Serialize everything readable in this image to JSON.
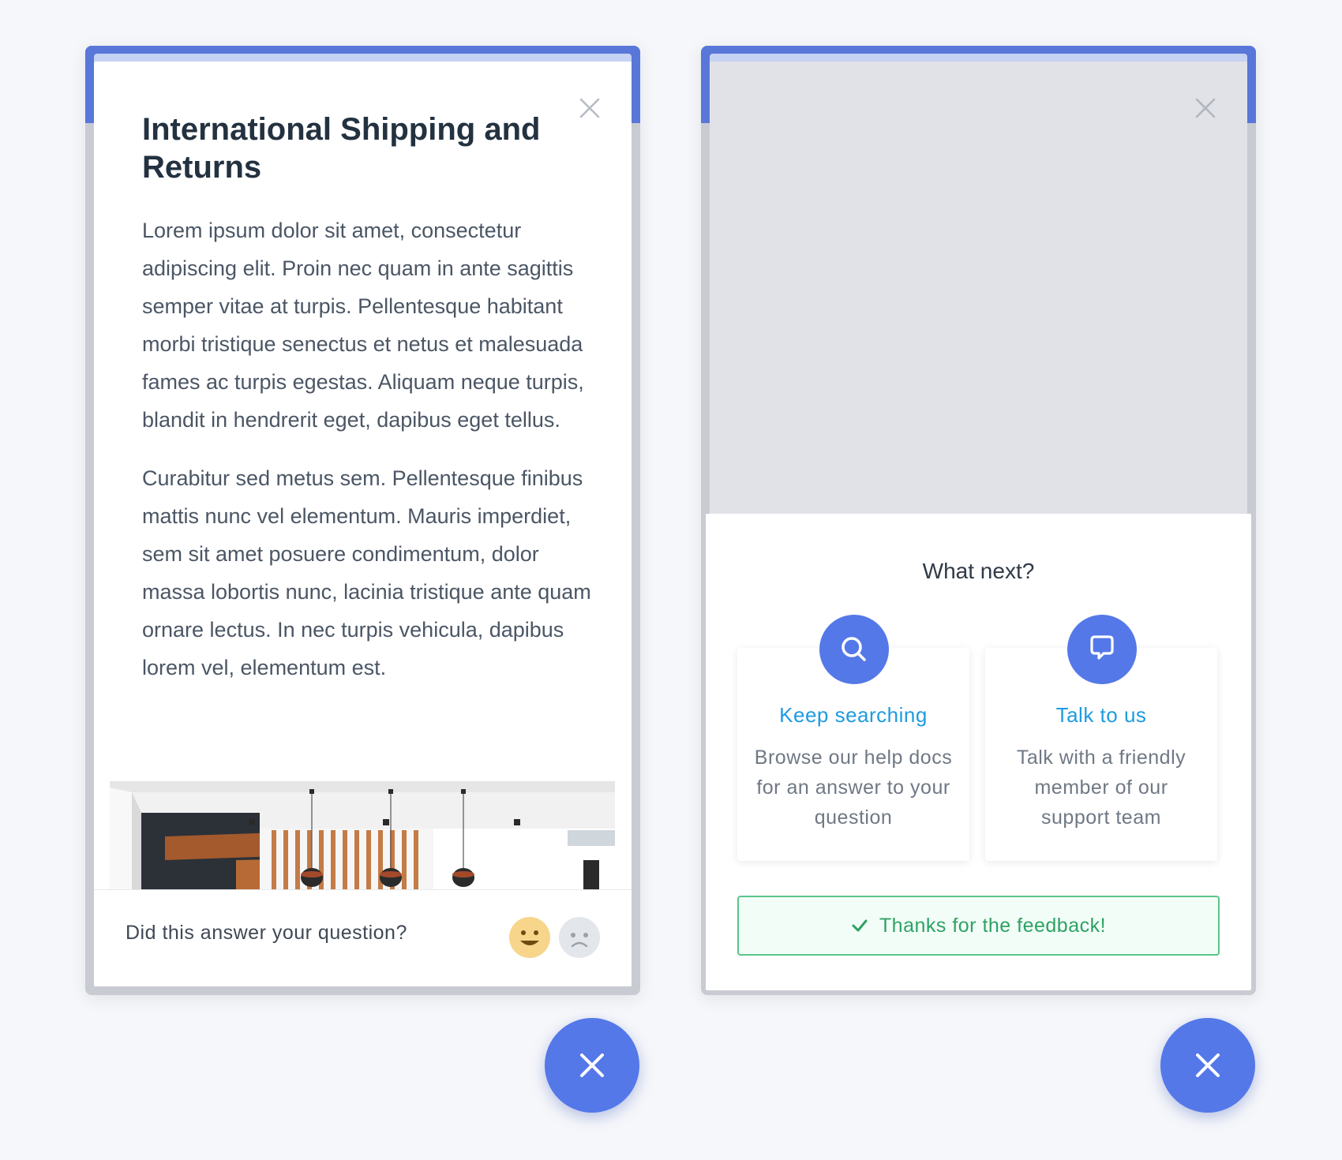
{
  "colors": {
    "accent": "#5478e8",
    "header_blue": "#5877d8",
    "link_blue": "#1e9be0",
    "success_green": "#2da264",
    "happy_yellow": "#f7d58b",
    "sad_gray": "#e3e6ea"
  },
  "left_widget": {
    "close_icon": "close-icon",
    "article": {
      "title": "International Shipping and Returns",
      "paragraphs": [
        "Lorem ipsum dolor sit amet, consectetur adipiscing elit. Proin nec quam in ante sagittis semper vitae at turpis. Pellentesque habitant morbi tristique senectus et netus et malesuada fames ac turpis egestas. Aliquam neque turpis, blandit in hendrerit eget, dapibus eget tellus.",
        "Curabitur sed metus sem. Pellentesque finibus mattis nunc vel elementum. Mauris imperdiet, sem sit amet posuere condimentum, dolor massa lobortis nunc, lacinia tristique ante quam ornare lectus. In nec turpis vehicula, dapibus lorem vel, elementum est."
      ],
      "image": "interior-photo"
    },
    "feedback": {
      "question": "Did this answer your question?",
      "happy_icon": "happy-face-icon",
      "sad_icon": "sad-face-icon"
    }
  },
  "right_widget": {
    "close_icon": "close-icon",
    "next": {
      "title": "What next?",
      "options": [
        {
          "icon": "search-icon",
          "title": "Keep searching",
          "description": "Browse our help docs for an answer to your question"
        },
        {
          "icon": "chat-bubble-icon",
          "title": "Talk to us",
          "description": "Talk with a friendly member of our support team"
        }
      ],
      "confirmation": "Thanks for the feedback!",
      "confirmation_icon": "check-icon"
    }
  },
  "fab_icon": "close-icon"
}
